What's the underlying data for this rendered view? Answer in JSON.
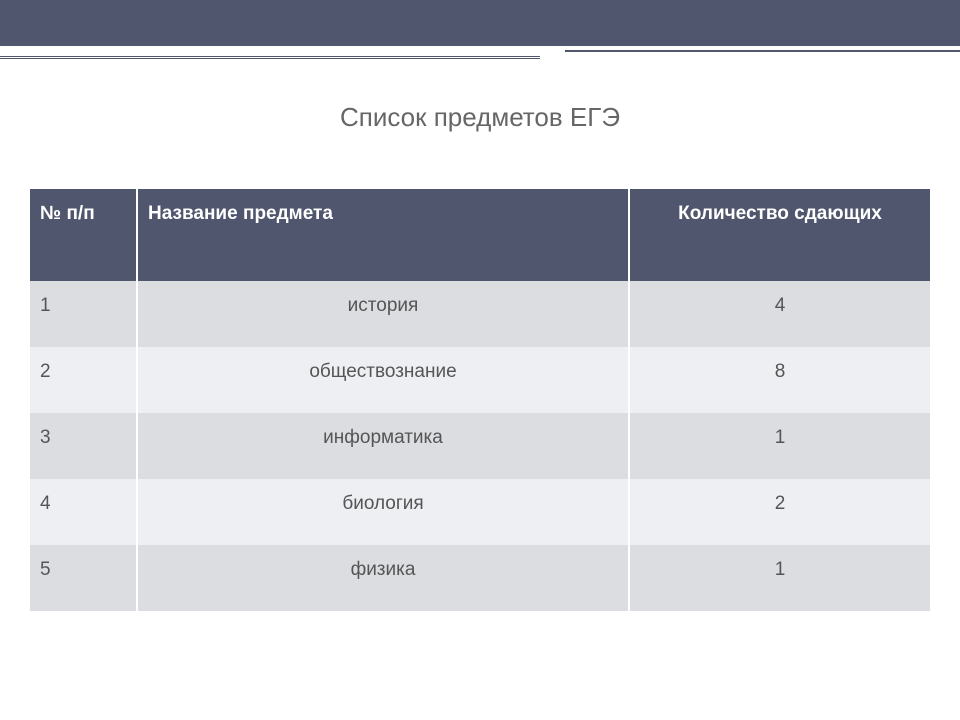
{
  "title": "Список предметов ЕГЭ",
  "table": {
    "headers": {
      "num": "№ п/п",
      "name": "Название предмета",
      "count": "Количество сдающих"
    },
    "rows": [
      {
        "num": "1",
        "name": "история",
        "count": "4"
      },
      {
        "num": "2",
        "name": "обществознание",
        "count": "8"
      },
      {
        "num": "3",
        "name": "информатика",
        "count": "1"
      },
      {
        "num": "4",
        "name": "биология",
        "count": "2"
      },
      {
        "num": "5",
        "name": "физика",
        "count": "1"
      }
    ]
  },
  "chart_data": {
    "type": "table",
    "title": "Список предметов ЕГЭ",
    "columns": [
      "№ п/п",
      "Название предмета",
      "Количество сдающих"
    ],
    "rows": [
      [
        1,
        "история",
        4
      ],
      [
        2,
        "обществознание",
        8
      ],
      [
        3,
        "информатика",
        1
      ],
      [
        4,
        "биология",
        2
      ],
      [
        5,
        "физика",
        1
      ]
    ]
  }
}
